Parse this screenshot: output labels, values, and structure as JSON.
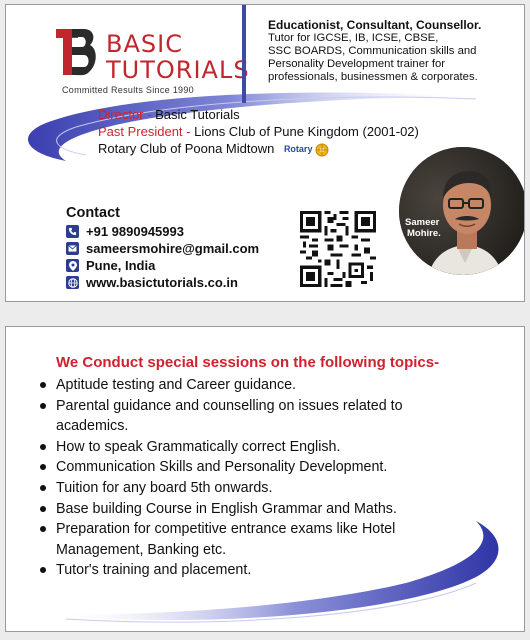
{
  "front": {
    "logo": {
      "line1": "BASIC",
      "line2": "TUTORIALS",
      "tagline": "Committed Results Since 1990"
    },
    "intro": {
      "headline": "Educationist, Consultant, Counsellor.",
      "lines": [
        "Tutor for IGCSE, IB, ICSE, CBSE,",
        "SSC BOARDS, Communication skills and",
        "Personality Development trainer for",
        "professionals, businessmen & corporates."
      ]
    },
    "roles": {
      "director_label": "Director - ",
      "director_value": "Basic Tutorials",
      "past_president_label": "Past President - ",
      "past_president_value": "Lions Club of Pune Kingdom (2001-02)",
      "rotary_club": "Rotary Club of Poona Midtown",
      "rotary_logo_text": "Rotary"
    },
    "contact": {
      "title": "Contact",
      "phone": "+91 9890945993",
      "email": "sameersmohire@gmail.com",
      "location": "Pune, India",
      "website": "www.basictutorials.co.in"
    },
    "photo": {
      "first_name": "Sameer",
      "last_name": "Mohire."
    },
    "colors": {
      "brand_red": "#c0272d",
      "label_red": "#d2202f",
      "accent_blue": "#3f4aa3",
      "icon_blue": "#2b3d8f"
    },
    "icons": [
      "logo-tb-icon",
      "phone-icon",
      "email-icon",
      "location-icon",
      "globe-icon",
      "rotary-wheel-icon",
      "qr-code-icon"
    ]
  },
  "back": {
    "title": "We Conduct special sessions on the following topics-",
    "topics": [
      "Aptitude testing and Career guidance.",
      "Parental guidance and counselling on issues related to",
      "academics.",
      "How to speak Grammatically correct English.",
      "Communication Skills and Personality Development.",
      "Tuition for any board 5th onwards.",
      "Base building Course in English Grammar and Maths.",
      "Preparation for competitive entrance exams like Hotel",
      "Management, Banking etc.",
      "Tutor's training and placement."
    ]
  }
}
